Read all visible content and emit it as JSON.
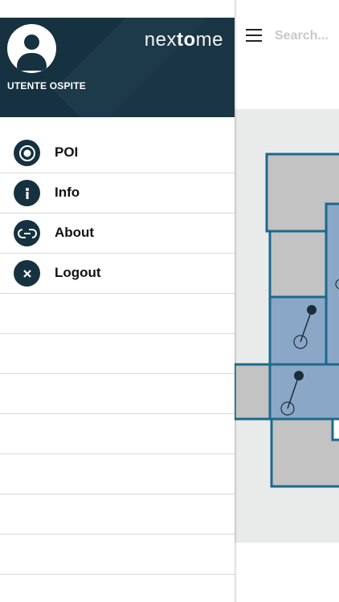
{
  "header": {
    "user_name": "UTENTE OSPITE",
    "brand_light1": "nex",
    "brand_bold": "to",
    "brand_light2": "me"
  },
  "menu": [
    {
      "label": "POI",
      "icon": "target-icon"
    },
    {
      "label": "Info",
      "icon": "info-icon"
    },
    {
      "label": "About",
      "icon": "infinity-link-icon"
    },
    {
      "label": "Logout",
      "icon": "close-icon"
    }
  ],
  "search": {
    "placeholder": "Search..."
  },
  "colors": {
    "primary": "#16313f",
    "map_wall": "#1b6a8d",
    "room_fill": "#c3c3c3",
    "room_blue": "#8ba7c7"
  }
}
